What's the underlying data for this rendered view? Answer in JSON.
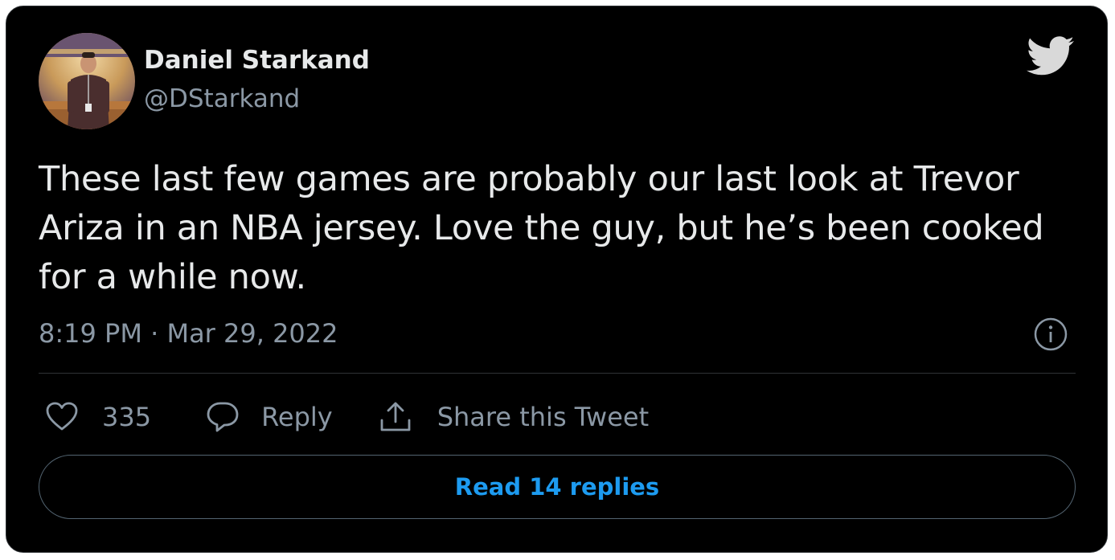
{
  "author": {
    "display_name": "Daniel Starkand",
    "handle": "@DStarkand"
  },
  "tweet": {
    "text": "These last few games are probably our last look at Trevor Ariza in an NBA jersey. Love the guy, but he’s been cooked for a while now.",
    "timestamp": "8:19 PM · Mar 29, 2022"
  },
  "actions": {
    "like_count": "335",
    "reply_label": "Reply",
    "share_label": "Share this Tweet"
  },
  "read_replies_label": "Read 14 replies",
  "icons": {
    "logo": "twitter-bird-icon",
    "info": "info-icon",
    "like": "heart-icon",
    "reply": "speech-bubble-icon",
    "share": "share-upload-icon"
  },
  "colors": {
    "background": "#000000",
    "text": "#e7e9ea",
    "secondary": "#8b98a5",
    "accent": "#1d9bf0",
    "border": "#2f3336"
  }
}
